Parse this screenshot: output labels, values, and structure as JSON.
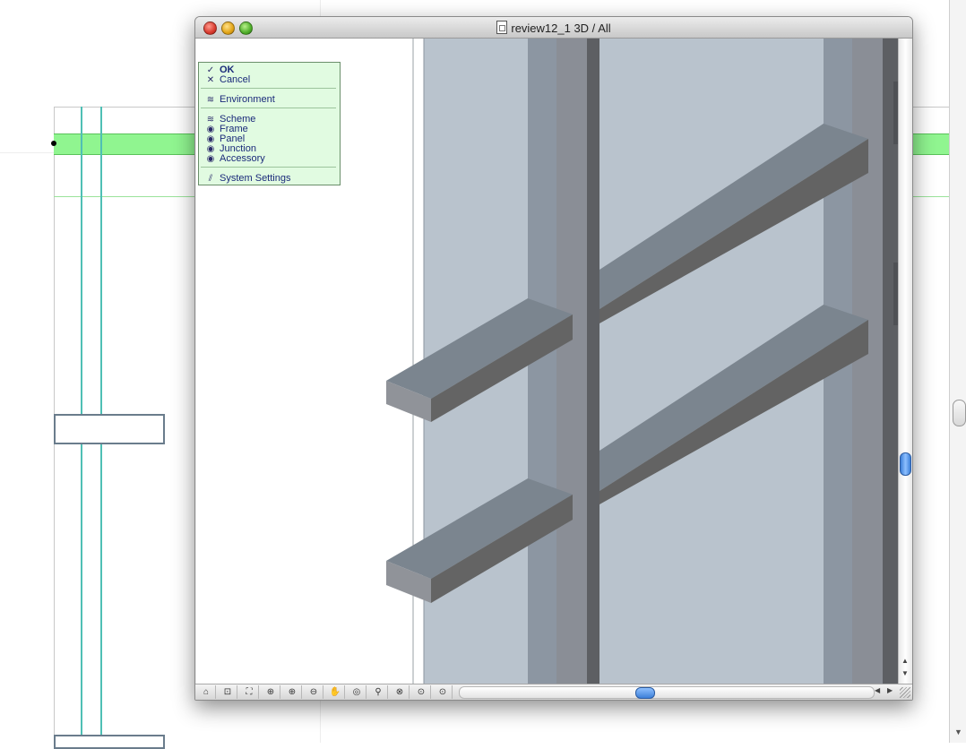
{
  "window": {
    "title": "review12_1 3D / All"
  },
  "palette": {
    "ok": {
      "label": "OK",
      "icon": "checkmark-icon"
    },
    "cancel": {
      "label": "Cancel",
      "icon": "x-icon"
    },
    "environment": {
      "label": "Environment",
      "icon": "layers-icon"
    },
    "scheme": {
      "label": "Scheme",
      "icon": "layers-icon"
    },
    "frame": {
      "label": "Frame",
      "icon": "eye-icon"
    },
    "panel": {
      "label": "Panel",
      "icon": "eye-icon"
    },
    "junction": {
      "label": "Junction",
      "icon": "eye-icon"
    },
    "accessory": {
      "label": "Accessory",
      "icon": "eye-icon"
    },
    "system_settings": {
      "label": "System Settings",
      "icon": "settings-layers-icon"
    }
  },
  "toolbar": {
    "tools": [
      {
        "name": "navigator-tool",
        "glyph": "⌂"
      },
      {
        "name": "select-tool",
        "glyph": "⊡"
      },
      {
        "name": "fit-in-window-tool",
        "glyph": "⛶"
      },
      {
        "name": "zoom-region-tool",
        "glyph": "⊕"
      },
      {
        "name": "zoom-in-tool",
        "glyph": "⊕"
      },
      {
        "name": "zoom-out-tool",
        "glyph": "⊖"
      },
      {
        "name": "pan-hand-tool",
        "glyph": "✋"
      },
      {
        "name": "orbit-tool",
        "glyph": "◎"
      },
      {
        "name": "walk-tool",
        "glyph": "⚲"
      },
      {
        "name": "zoom-previous-tool",
        "glyph": "⊗"
      },
      {
        "name": "zoom-back-tool",
        "glyph": "⊙"
      },
      {
        "name": "zoom-forward-tool",
        "glyph": "⊙"
      }
    ]
  },
  "scrollbars": {
    "horizontal_position": 0.45,
    "vertical_position": 0.68
  },
  "colors": {
    "palette_bg": "#e1fbe1",
    "highlight_green": "#90f590",
    "plan_cyan": "#4fbfb5",
    "glass": "#b9c3cd",
    "mullion": "#8a919b",
    "beam_top": "#7b858f",
    "beam_side": "#636363"
  }
}
